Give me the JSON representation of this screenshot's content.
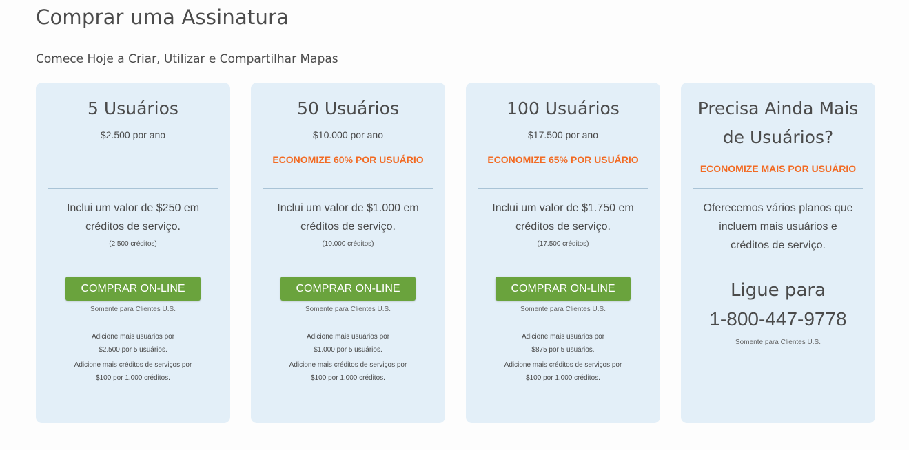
{
  "header": {
    "title": "Comprar uma Assinatura",
    "subtitle": "Comece Hoje a Criar, Utilizar e Compartilhar Mapas"
  },
  "colors": {
    "card_bg": "#e3eff8",
    "accent_orange": "#f26a22",
    "button_green": "#6aa33d"
  },
  "plans": [
    {
      "title": "5 Usuários",
      "price": "$2.500 por ano",
      "savings": "",
      "included_line1": "Inclui um valor de $250 em",
      "included_line2": "créditos de serviço.",
      "credits": "(2.500 créditos)",
      "button": "COMPRAR ON-LINE",
      "note": "Somente para Clientes U.S.",
      "add_users_line1": "Adicione mais usuários por",
      "add_users_line2": "$2.500 por 5 usuários.",
      "add_credits_line1": "Adicione mais créditos de serviços por",
      "add_credits_line2": "$100 por 1.000 créditos."
    },
    {
      "title": "50 Usuários",
      "price": "$10.000 por ano",
      "savings": "ECONOMIZE 60% POR USUÁRIO",
      "included_line1": "Inclui um valor de $1.000 em",
      "included_line2": "créditos de serviço.",
      "credits": "(10.000 créditos)",
      "button": "COMPRAR ON-LINE",
      "note": "Somente para Clientes U.S.",
      "add_users_line1": "Adicione mais usuários por",
      "add_users_line2": "$1.000 por 5 usuários.",
      "add_credits_line1": "Adicione mais créditos de serviços por",
      "add_credits_line2": "$100 por 1.000 créditos."
    },
    {
      "title": "100 Usuários",
      "price": "$17.500 por ano",
      "savings": "ECONOMIZE 65% POR USUÁRIO",
      "included_line1": "Inclui um valor de $1.750 em",
      "included_line2": "créditos de serviço.",
      "credits": "(17.500 créditos)",
      "button": "COMPRAR ON-LINE",
      "note": "Somente para Clientes U.S.",
      "add_users_line1": "Adicione mais usuários por",
      "add_users_line2": "$875 por 5 usuários.",
      "add_credits_line1": "Adicione mais créditos de serviços por",
      "add_credits_line2": "$100 por 1.000 créditos."
    }
  ],
  "enterprise": {
    "title_line1": "Precisa Ainda Mais",
    "title_line2": "de Usuários?",
    "savings": "ECONOMIZE MAIS POR USUÁRIO",
    "desc_line1": "Oferecemos vários planos que",
    "desc_line2": "incluem mais usuários e",
    "desc_line3": "créditos de serviço.",
    "call_label": "Ligue para",
    "phone": "1-800-447-9778",
    "note": "Somente para Clientes U.S."
  }
}
